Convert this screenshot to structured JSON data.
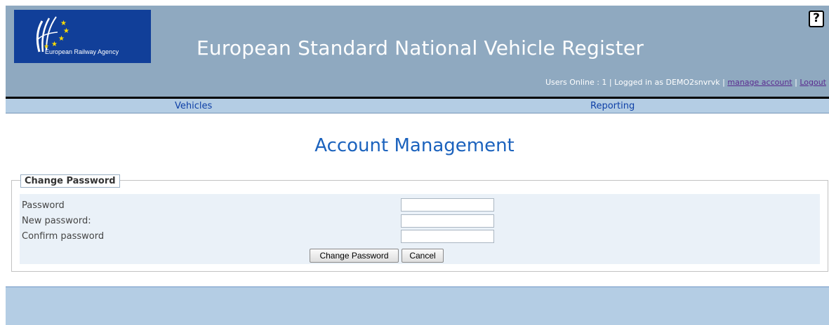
{
  "header": {
    "logo_text": "European Railway Agency",
    "site_title": "European Standard National Vehicle Register",
    "help_icon": "help-question-icon",
    "users_online": "Users Online : 1 | Logged in as DEMO2snvrvk | ",
    "manage_account": "manage account",
    "separator": " | ",
    "logout": "Logout"
  },
  "nav": {
    "vehicles": "Vehicles",
    "reporting": "Reporting"
  },
  "page": {
    "title": "Account Management"
  },
  "form": {
    "legend": "Change Password",
    "password_label": "Password",
    "new_password_label": "New password:",
    "confirm_password_label": "Confirm password",
    "password_value": "",
    "new_password_value": "",
    "confirm_password_value": "",
    "change_button": "Change Password",
    "cancel_button": "Cancel"
  },
  "colors": {
    "header_bg": "#8fa9c0",
    "nav_bg": "#b4cde4",
    "logo_bg": "#113f99",
    "title": "#1b62bd"
  }
}
